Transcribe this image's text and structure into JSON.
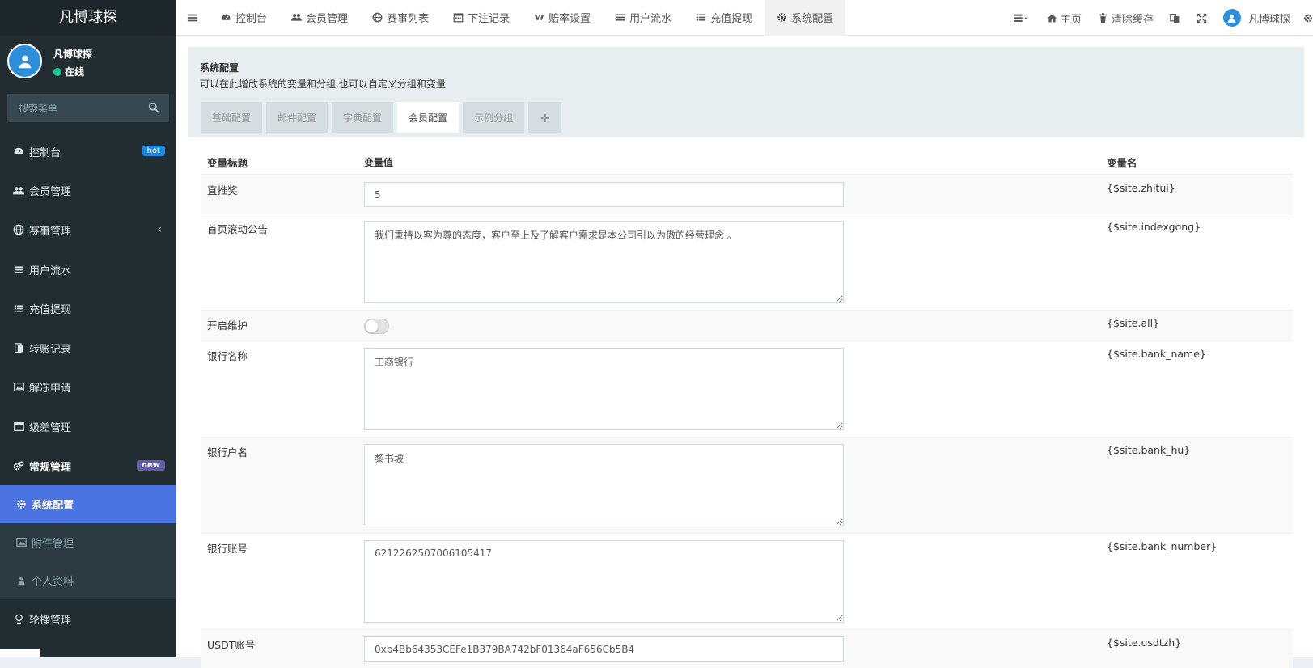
{
  "app": {
    "title": "凡博球探"
  },
  "user": {
    "name": "凡博球探",
    "status": "在线"
  },
  "search": {
    "placeholder": "搜索菜单"
  },
  "sidebar": {
    "items": [
      {
        "label": "控制台",
        "icon": "dashboard-icon",
        "badge": "hot"
      },
      {
        "label": "会员管理",
        "icon": "users-icon"
      },
      {
        "label": "赛事管理",
        "icon": "globe-icon",
        "chevron": "‹"
      },
      {
        "label": "用户流水",
        "icon": "list-icon"
      },
      {
        "label": "充值提现",
        "icon": "list-alt-icon"
      },
      {
        "label": "转账记录",
        "icon": "transfer-icon"
      },
      {
        "label": "解冻申请",
        "icon": "image-icon"
      },
      {
        "label": "级差管理",
        "icon": "window-icon"
      },
      {
        "label": "常规管理",
        "icon": "cogs-icon",
        "badge": "new"
      }
    ],
    "sub_items": [
      {
        "label": "系统配置",
        "icon": "gear-icon",
        "active": true
      },
      {
        "label": "附件管理",
        "icon": "image-icon"
      },
      {
        "label": "个人资料",
        "icon": "user-icon"
      }
    ],
    "last_item": {
      "label": "轮播管理",
      "icon": "carousel-icon"
    }
  },
  "topnav": {
    "tabs": [
      {
        "label": "控制台",
        "icon": "dashboard-icon"
      },
      {
        "label": "会员管理",
        "icon": "users-icon"
      },
      {
        "label": "赛事列表",
        "icon": "globe-icon"
      },
      {
        "label": "下注记录",
        "icon": "calendar-icon"
      },
      {
        "label": "赔率设置",
        "icon": "vk-icon"
      },
      {
        "label": "用户流水",
        "icon": "list-icon"
      },
      {
        "label": "充值提现",
        "icon": "list-alt-icon"
      },
      {
        "label": "系统配置",
        "icon": "gear-icon",
        "active": true
      }
    ],
    "right": {
      "home": "主页",
      "clear_cache": "清除缓存",
      "username": "凡博球探"
    }
  },
  "panel": {
    "title": "系统配置",
    "description": "可以在此增改系统的变量和分组,也可以自定义分组和变量",
    "tabs": [
      "基础配置",
      "邮件配置",
      "字典配置",
      "会员配置",
      "示例分组"
    ],
    "active_tab": 3,
    "add_tab": "+"
  },
  "table": {
    "headers": {
      "title": "变量标题",
      "value": "变量值",
      "name": "变量名"
    },
    "rows": [
      {
        "title": "直推奖",
        "type": "input",
        "value": "5",
        "name": "{$site.zhitui}"
      },
      {
        "title": "首页滚动公告",
        "type": "textarea",
        "value": "我们秉持以客为尊的态度，客户至上及了解客户需求是本公司引以为傲的经营理念 。",
        "name": "{$site.indexgong}"
      },
      {
        "title": "开启维护",
        "type": "toggle",
        "value": "off",
        "name": "{$site.all}"
      },
      {
        "title": "银行名称",
        "type": "textarea",
        "value": "工商银行",
        "name": "{$site.bank_name}"
      },
      {
        "title": "银行户名",
        "type": "textarea",
        "value": "黎书坡",
        "name": "{$site.bank_hu}"
      },
      {
        "title": "银行账号",
        "type": "textarea",
        "value": "6212262507006105417",
        "name": "{$site.bank_number}"
      },
      {
        "title": "USDT账号",
        "type": "input",
        "value": "0xb4Bb64353CEFe1B379BA742bF01364aF656Cb5B4",
        "name": "{$site.usdtzh}"
      }
    ]
  },
  "colors": {
    "sidebar_bg": "#222d32",
    "active": "#4a72e0",
    "hot": "#1e88e5",
    "new": "#605ca8",
    "online": "#20c997"
  }
}
